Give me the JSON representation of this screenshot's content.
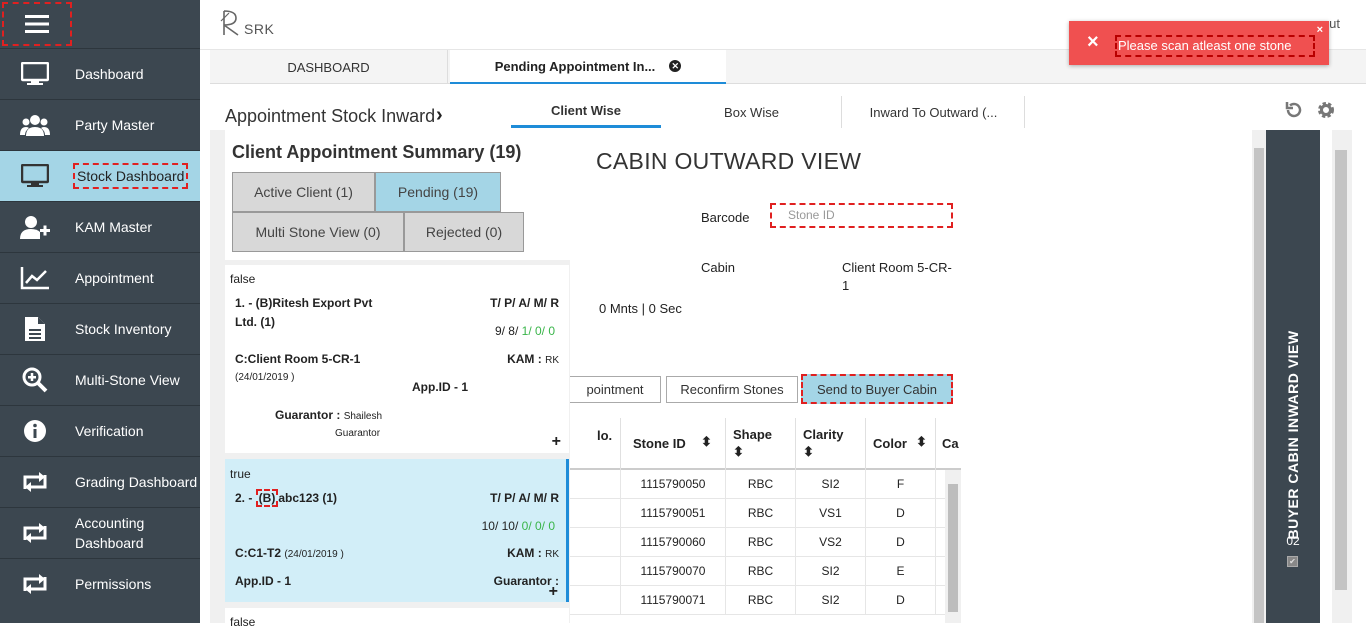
{
  "app": {
    "logo_text": "SRK",
    "logout_peek": "ut"
  },
  "sidebar": {
    "items": [
      {
        "label": "Dashboard",
        "icon": "monitor-icon"
      },
      {
        "label": "Party Master",
        "icon": "users-icon"
      },
      {
        "label": "Stock Dashboard",
        "icon": "monitor-icon",
        "active": true
      },
      {
        "label": "KAM Master",
        "icon": "add-user-icon"
      },
      {
        "label": "Appointment",
        "icon": "chart-line-icon"
      },
      {
        "label": "Stock Inventory",
        "icon": "document-icon"
      },
      {
        "label": "Multi-Stone View",
        "icon": "zoom-in-icon"
      },
      {
        "label": "Verification",
        "icon": "info-icon"
      },
      {
        "label": "Grading Dashboard",
        "icon": "retweet-icon"
      },
      {
        "label": "Accounting Dashboard",
        "icon": "retweet-icon"
      },
      {
        "label": "Permissions",
        "icon": "retweet-icon"
      }
    ]
  },
  "tabs": {
    "dashboard": "DASHBOARD",
    "pending": "Pending Appointment In..."
  },
  "page": {
    "title": "Appointment Stock Inward",
    "subtabs": {
      "client": "Client Wise",
      "box": "Box Wise",
      "inward": "Inward To Outward (..."
    }
  },
  "summary": {
    "title": "Client Appointment Summary (19)",
    "filters": {
      "active": "Active Client (1)",
      "pending": "Pending (19)",
      "multi": "Multi Stone View (0)",
      "rejected": "Rejected (0)"
    }
  },
  "cards": [
    {
      "flag": "false",
      "name_line1": "1. - (B)Ritesh Export Pvt",
      "name_line2": "Ltd. (1)",
      "tpam_label": "T/ P/ A/ M/ R",
      "counts_a": "9/ 8/ ",
      "counts_b": "1/ 0/ 0",
      "cabin": "C:Client Room 5-CR-1",
      "date": "(24/01/2019 )",
      "kam": "KAM :",
      "kam_val": "RK",
      "appid": "App.ID - 1",
      "guarantor": "Guarantor :",
      "guarantor_val": "Shailesh",
      "guarantor_val2": "Guarantor"
    },
    {
      "flag": "true",
      "name_pre": "2. - ",
      "name_mark": "(B)",
      "name_post": "abc123 (1)",
      "tpam_label": "T/ P/ A/ M/ R",
      "counts_a": "10/ 10/ ",
      "counts_b": "0/ 0/ 0",
      "cabin": "C:C1-T2",
      "date": "(24/01/2019 )",
      "kam": "KAM :",
      "kam_val": "RK",
      "appid": "App.ID - 1",
      "guarantor": "Guarantor :"
    },
    {
      "flag": "false"
    }
  ],
  "main": {
    "title": "CABIN OUTWARD VIEW",
    "barcode_label": "Barcode",
    "stone_placeholder": "Stone ID",
    "cabin_label": "Cabin",
    "cabin_value1": "Client Room 5-CR-",
    "cabin_value2": "1",
    "timer": "0 Mnts | 0 Sec",
    "buttons": {
      "appointment": "pointment",
      "reconfirm": "Reconfirm Stones",
      "send": "Send to Buyer Cabin"
    },
    "table": {
      "headers": {
        "no": "lo.",
        "stone": "Stone ID",
        "shape": "Shape",
        "clarity": "Clarity",
        "color": "Color",
        "ca": "Ca"
      },
      "rows": [
        {
          "stone": "1115790050",
          "shape": "RBC",
          "clarity": "SI2",
          "color": "F"
        },
        {
          "stone": "1115790051",
          "shape": "RBC",
          "clarity": "VS1",
          "color": "D"
        },
        {
          "stone": "1115790060",
          "shape": "RBC",
          "clarity": "VS2",
          "color": "D"
        },
        {
          "stone": "1115790070",
          "shape": "RBC",
          "clarity": "SI2",
          "color": "E"
        },
        {
          "stone": "1115790071",
          "shape": "RBC",
          "clarity": "SI2",
          "color": "D"
        }
      ]
    }
  },
  "buyer_panel": {
    "label": "BUYER CABIN INWARD VIEW",
    "count": "02"
  },
  "toast": {
    "message": "Please scan atleast one stone",
    "close": "×",
    "icon": "×"
  },
  "colors": {
    "sidebar": "#3c4750",
    "active": "#a4d5e6",
    "accent": "#1e8cd8",
    "toast": "#f05050"
  }
}
